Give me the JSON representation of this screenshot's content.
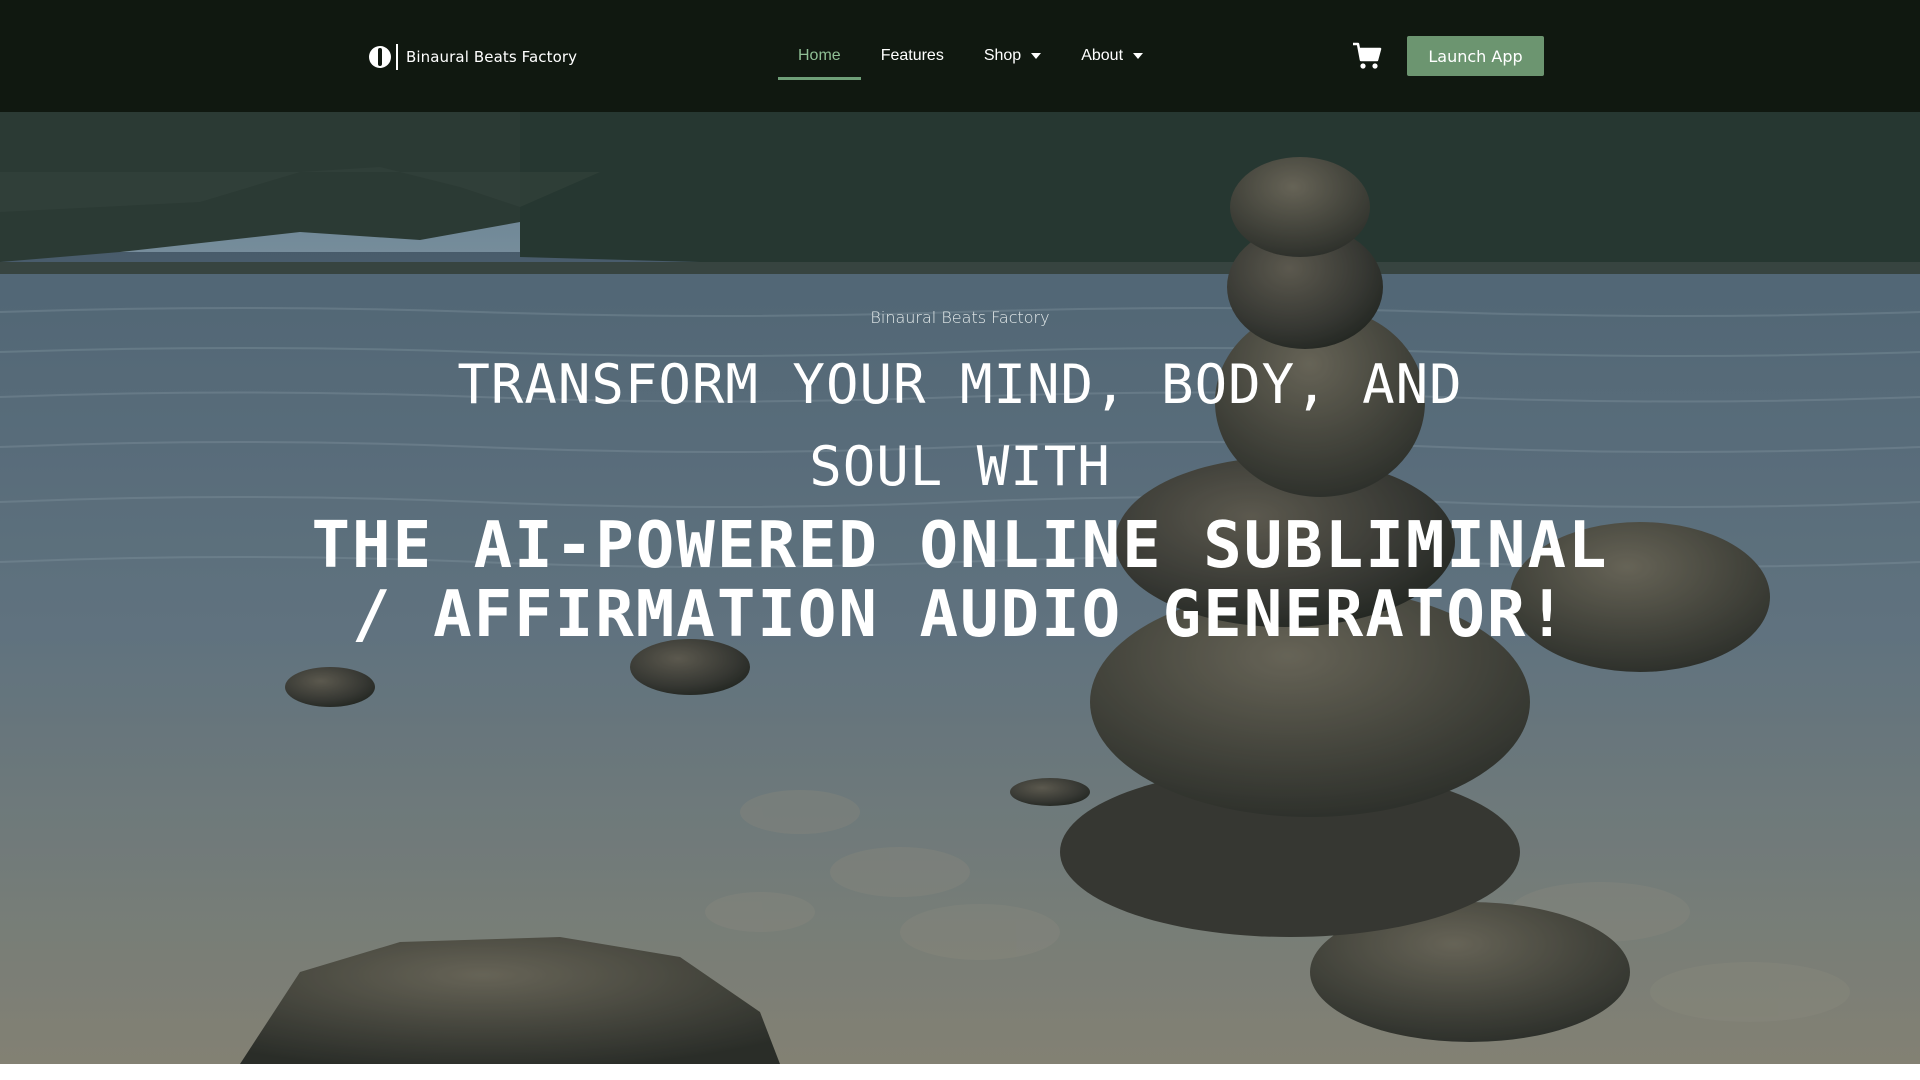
{
  "brand": {
    "name": "Binaural Beats Factory",
    "logo_icon": "circle-split-logo-icon"
  },
  "nav": {
    "items": [
      {
        "label": "Home",
        "active": true
      },
      {
        "label": "Features",
        "active": false
      },
      {
        "label": "Shop",
        "has_dropdown": true
      },
      {
        "label": "About",
        "has_dropdown": true
      }
    ]
  },
  "header": {
    "cart_icon": "shopping-cart-icon",
    "launch_label": "Launch App"
  },
  "hero": {
    "eyebrow": "Binaural Beats Factory",
    "headline": "TRANSFORM YOUR MIND, BODY, AND SOUL WITH",
    "subheadline": "THE AI-POWERED ONLINE SUBLIMINAL / AFFIRMATION AUDIO GENERATOR!",
    "background": "lake-with-stacked-rocks-photo"
  },
  "colors": {
    "header_bg": "#101810",
    "accent": "#6c9570",
    "active_nav": "#8fbf95"
  }
}
